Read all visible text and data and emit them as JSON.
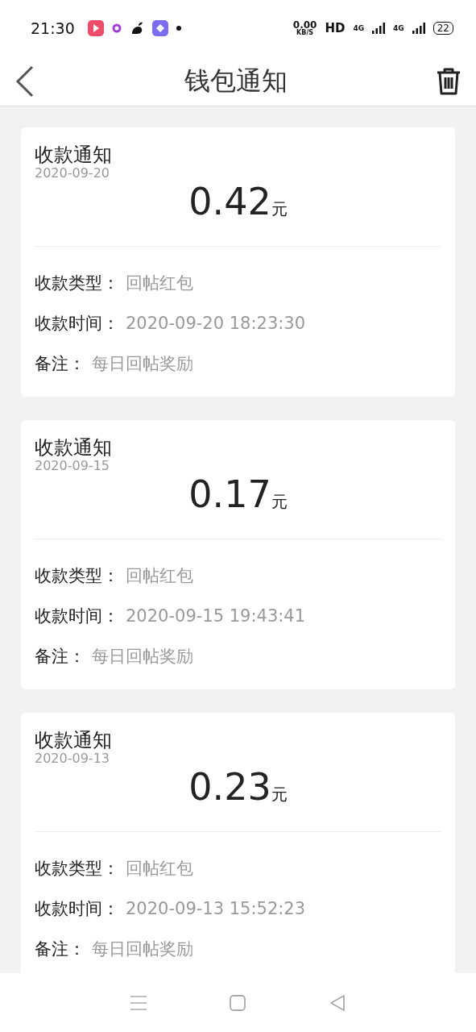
{
  "status_bar": {
    "time": "21:30",
    "net_speed": "0.00",
    "net_unit": "KB/S",
    "hd": "HD",
    "sim1": "4G",
    "sim2": "4G",
    "battery": "22"
  },
  "header": {
    "title": "钱包通知"
  },
  "notices": [
    {
      "title": "收款通知",
      "date": "2020-09-20",
      "amount": "0.42",
      "unit": "元",
      "rows": [
        {
          "label": "收款类型：",
          "value": "回帖红包"
        },
        {
          "label": "收款时间：",
          "value": "2020-09-20 18:23:30"
        },
        {
          "label": "备注：",
          "value": "每日回帖奖励"
        }
      ]
    },
    {
      "title": "收款通知",
      "date": "2020-09-15",
      "amount": "0.17",
      "unit": "元",
      "rows": [
        {
          "label": "收款类型：",
          "value": "回帖红包"
        },
        {
          "label": "收款时间：",
          "value": "2020-09-15 19:43:41"
        },
        {
          "label": "备注：",
          "value": "每日回帖奖励"
        }
      ]
    },
    {
      "title": "收款通知",
      "date": "2020-09-13",
      "amount": "0.23",
      "unit": "元",
      "rows": [
        {
          "label": "收款类型：",
          "value": "回帖红包"
        },
        {
          "label": "收款时间：",
          "value": "2020-09-13 15:52:23"
        },
        {
          "label": "备注：",
          "value": "每日回帖奖励"
        }
      ]
    }
  ]
}
